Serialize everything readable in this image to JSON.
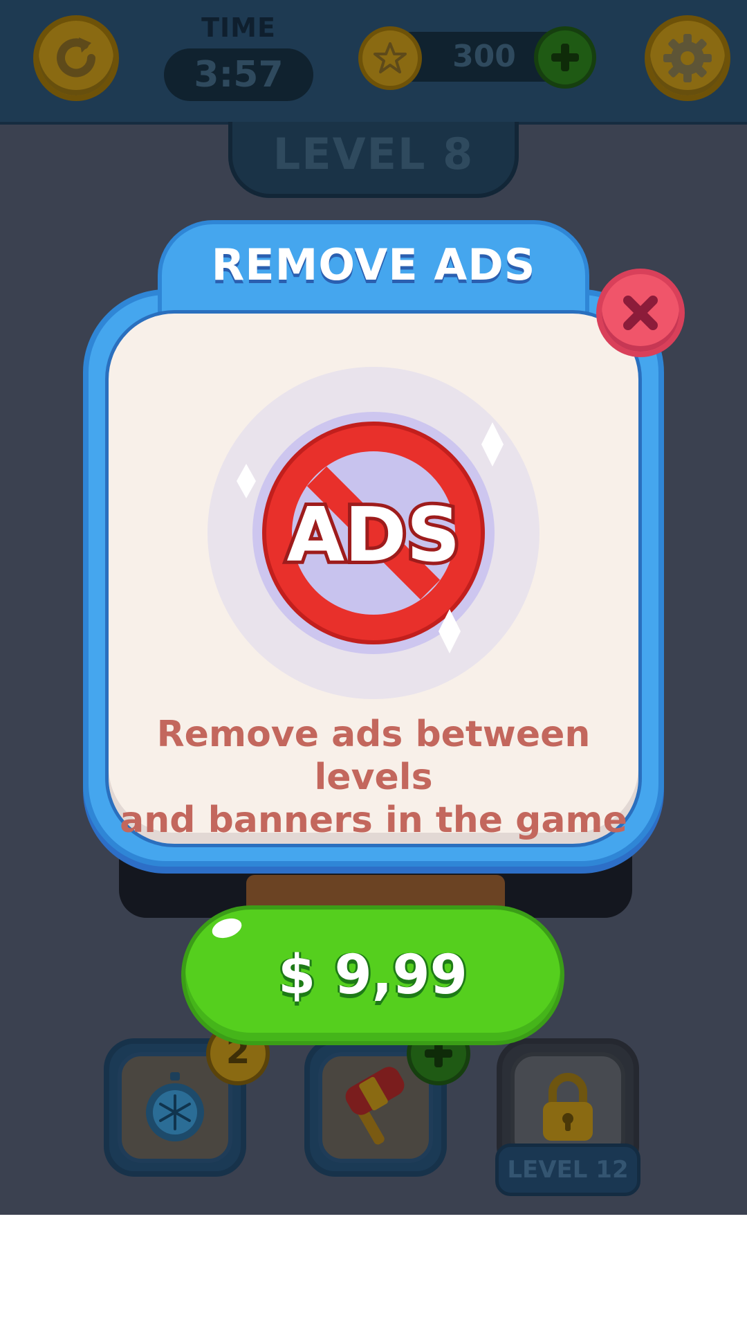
{
  "top_bar": {
    "restart_icon": "restart-icon",
    "time_label": "TIME",
    "time_value": "3:57",
    "coin_icon": "star-coin-icon",
    "coins": "300",
    "add_coins_icon": "plus-icon",
    "settings_icon": "gear-icon"
  },
  "level": {
    "title": "LEVEL 8"
  },
  "modal": {
    "title": "REMOVE ADS",
    "close_icon": "close-icon",
    "illustration_text": "ADS",
    "description_line1": "Remove ads between levels",
    "description_line2": "and banners in the game",
    "price": "$ 9,99"
  },
  "boosters": {
    "freeze_icon": "stopwatch-freeze-icon",
    "freeze_count": "2",
    "hammer_icon": "hammer-icon",
    "hammer_add_icon": "plus-icon",
    "locked_icon": "padlock-icon",
    "locked_label": "LEVEL 12"
  },
  "colors": {
    "modal_blue": "#45a6ee",
    "modal_body": "#f8f0e9",
    "close_red": "#f0556a",
    "price_green": "#55cf1e",
    "desc_text": "#c3675d",
    "ads_red": "#e8302b"
  }
}
